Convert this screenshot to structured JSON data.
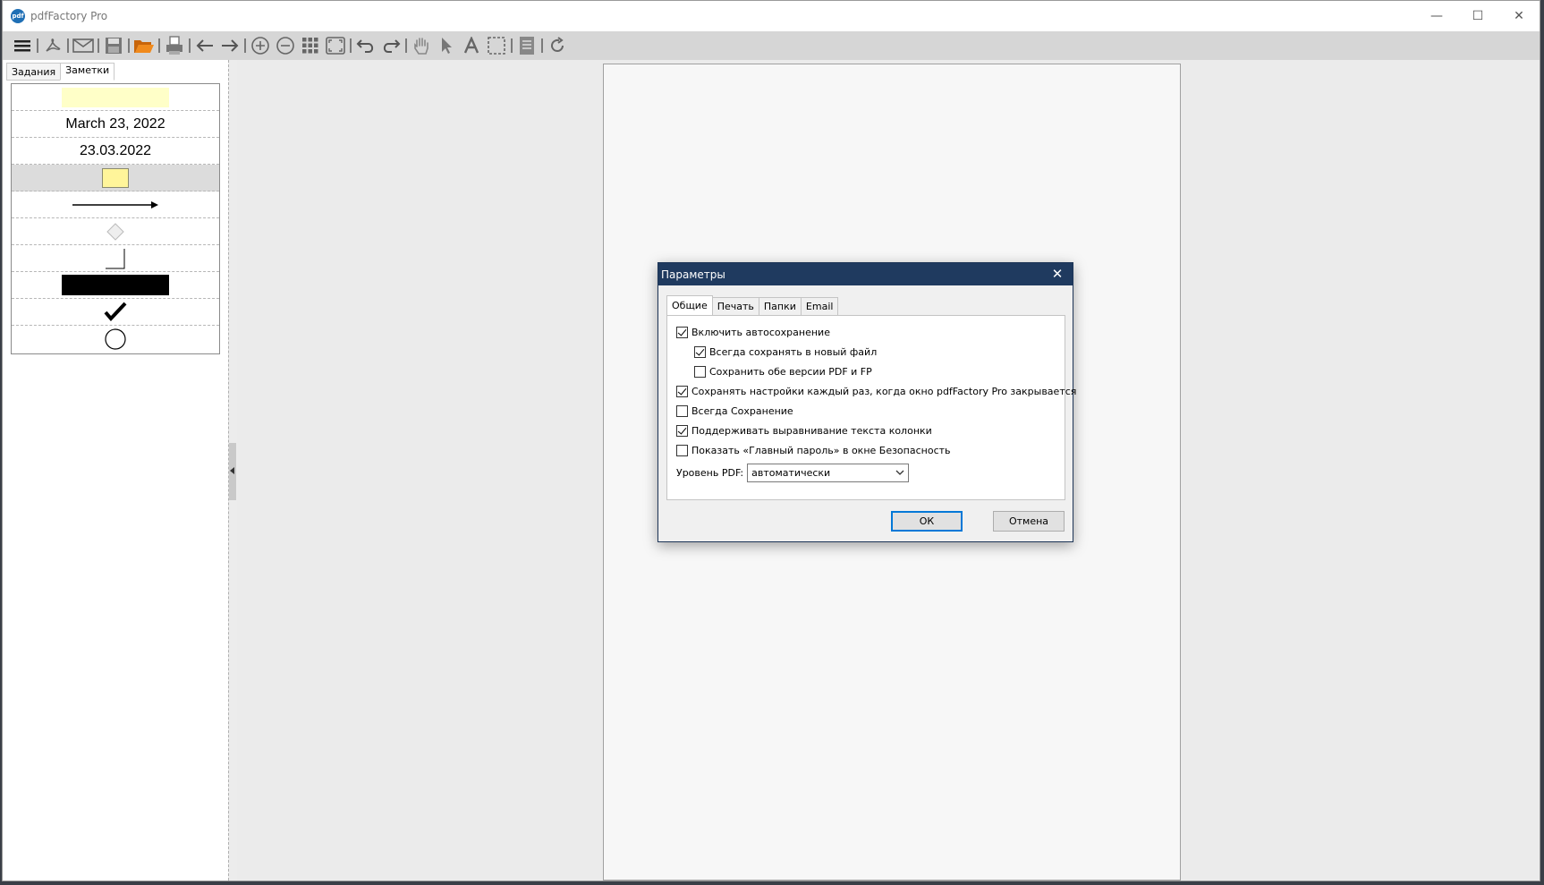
{
  "window": {
    "title": "pdfFactory Pro",
    "app_icon_text": "pdf"
  },
  "titlebar_controls": {
    "minimize": "—",
    "maximize": "☐",
    "close": "✕"
  },
  "toolbar": {
    "items": [
      "menu-icon",
      "acrobat-icon",
      "email-icon",
      "save-icon",
      "open-folder-icon",
      "print-icon",
      "back-arrow-icon",
      "forward-arrow-icon",
      "zoom-in-icon",
      "zoom-out-icon",
      "thumbnails-grid-icon",
      "fit-page-icon",
      "undo-icon",
      "redo-icon",
      "hand-tool-icon",
      "pointer-tool-icon",
      "text-tool-icon",
      "selection-tool-icon",
      "notes-icon",
      "refresh-icon"
    ]
  },
  "sidebar": {
    "tabs": [
      {
        "label": "Задания",
        "active": false
      },
      {
        "label": "Заметки",
        "active": true
      }
    ],
    "notes": [
      {
        "kind": "highlight"
      },
      {
        "kind": "text",
        "text": "March 23, 2022"
      },
      {
        "kind": "text",
        "text": "23.03.2022"
      },
      {
        "kind": "sticky-note",
        "selected": true
      },
      {
        "kind": "arrow"
      },
      {
        "kind": "diamond"
      },
      {
        "kind": "corner-line"
      },
      {
        "kind": "black-rectangle"
      },
      {
        "kind": "checkmark"
      },
      {
        "kind": "circle"
      }
    ]
  },
  "dialog": {
    "title": "Параметры",
    "close_glyph": "✕",
    "tabs": [
      {
        "label": "Общие",
        "active": true
      },
      {
        "label": "Печать",
        "active": false
      },
      {
        "label": "Папки",
        "active": false
      },
      {
        "label": "Email",
        "active": false
      }
    ],
    "options": [
      {
        "label": "Включить автосохранение",
        "checked": true
      },
      {
        "label": "Всегда сохранять в новый файл",
        "checked": true
      },
      {
        "label": "Сохранить обе версии PDF и FP",
        "checked": false
      },
      {
        "label": "Сохранять настройки каждый раз, когда окно pdfFactory Pro закрывается",
        "checked": true
      },
      {
        "label": "Всегда Сохранение",
        "checked": false
      },
      {
        "label": "Поддерживать выравнивание текста колонки",
        "checked": true
      },
      {
        "label": "Показать «Главный пароль» в окне Безопасность",
        "checked": false
      }
    ],
    "pdf_level_label": "Уровень PDF:",
    "pdf_level_value": "автоматически",
    "ok_label": "ОК",
    "cancel_label": "Отмена"
  },
  "colors": {
    "dialog_title_bg": "#1f3a5f",
    "accent_orange": "#e07a10",
    "sticky_yellow": "#fff59a",
    "highlight_yellow": "#ffffc8"
  }
}
